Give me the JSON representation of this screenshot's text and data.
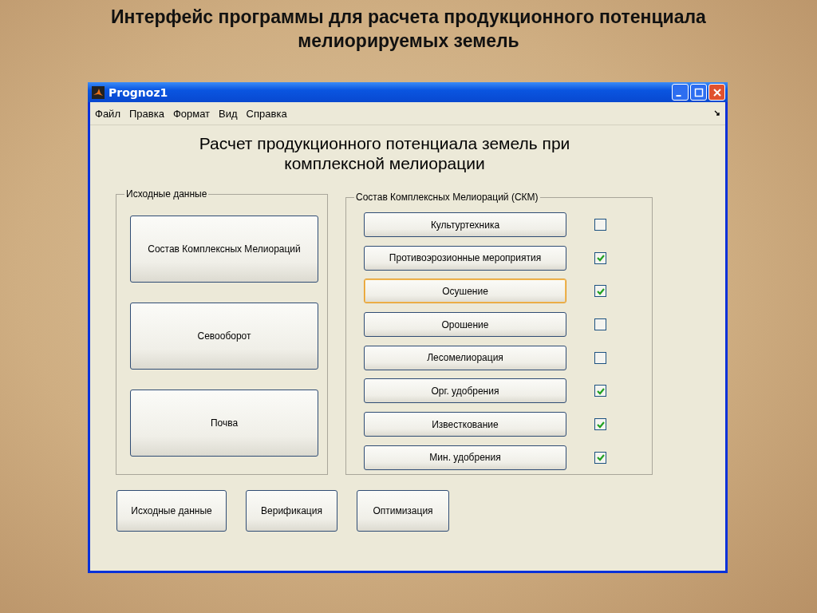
{
  "slide_title": "Интерфейс программы для расчета продукционного потенциала мелиорируемых земель",
  "window": {
    "title": "Prognoz1"
  },
  "menu": [
    "Файл",
    "Правка",
    "Формат",
    "Вид",
    "Справка"
  ],
  "heading": "Расчет продукционного потенциала земель при комплексной мелиорации",
  "source_group": {
    "title": "Исходные данные",
    "buttons": [
      "Состав Комплексных Мелиораций",
      "Севооборот",
      "Почва"
    ]
  },
  "skm_group": {
    "title": "Состав Комплексных Мелиораций (СКМ)",
    "items": [
      {
        "label": "Культуртехника",
        "checked": false,
        "focused": false
      },
      {
        "label": "Противоэрозионные мероприятия",
        "checked": true,
        "focused": false
      },
      {
        "label": "Осушение",
        "checked": true,
        "focused": true
      },
      {
        "label": "Орошение",
        "checked": false,
        "focused": false
      },
      {
        "label": "Лесомелиорация",
        "checked": false,
        "focused": false
      },
      {
        "label": "Орг. удобрения",
        "checked": true,
        "focused": false
      },
      {
        "label": "Известкование",
        "checked": true,
        "focused": false
      },
      {
        "label": "Мин. удобрения",
        "checked": true,
        "focused": false
      }
    ]
  },
  "bottom_buttons": [
    "Исходные данные",
    "Верификация",
    "Оптимизация"
  ]
}
